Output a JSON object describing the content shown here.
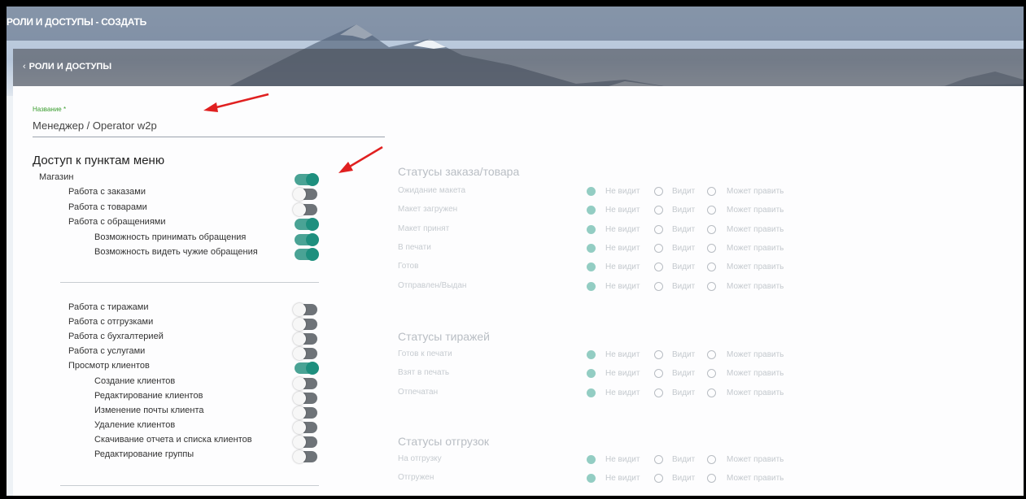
{
  "header": {
    "title": "РОЛИ И ДОСТУПЫ - СОЗДАТЬ",
    "back_label": "РОЛИ И ДОСТУПЫ"
  },
  "form": {
    "name_label": "Название *",
    "name_value": "Менеджер / Operator w2p"
  },
  "menu_access": {
    "title": "Доступ к пунктам меню",
    "items_a": [
      {
        "label": "Магазин",
        "on": true
      },
      {
        "label": "Работа с заказами",
        "on": false
      },
      {
        "label": "Работа с товарами",
        "on": false
      },
      {
        "label": "Работа с обращениями",
        "on": true
      },
      {
        "label": "Возможность принимать обращения",
        "on": true
      },
      {
        "label": "Возможность видеть чужие обращения",
        "on": true
      }
    ],
    "items_b": [
      {
        "label": "Работа с тиражами",
        "on": false
      },
      {
        "label": "Работа с отгрузками",
        "on": false
      },
      {
        "label": "Работа с бухгалтерией",
        "on": false
      },
      {
        "label": "Работа с услугами",
        "on": false
      },
      {
        "label": "Просмотр клиентов",
        "on": true
      },
      {
        "label": "Создание клиентов",
        "on": false
      },
      {
        "label": "Редактирование клиентов",
        "on": false
      },
      {
        "label": "Изменение почты клиента",
        "on": false
      },
      {
        "label": "Удаление клиентов",
        "on": false
      },
      {
        "label": "Скачивание отчета и списка клиентов",
        "on": false
      },
      {
        "label": "Редактирование группы",
        "on": false
      }
    ]
  },
  "radio_options": {
    "hidden": "Не видит",
    "view": "Видит",
    "edit": "Может править"
  },
  "status_groups": [
    {
      "title": "Статусы заказа/товара",
      "rows": [
        "Ожидание макета",
        "Макет загружен",
        "Макет принят",
        "В печати",
        "Готов",
        "Отправлен/Выдан"
      ]
    },
    {
      "title": "Статусы тиражей",
      "rows": [
        "Готов к печати",
        "Взят в печать",
        "Отпечатан"
      ]
    },
    {
      "title": "Статусы отгрузок",
      "rows": [
        "На отгрузку",
        "Отгружен"
      ]
    }
  ],
  "colors": {
    "accent": "#1e8f7e",
    "label_green": "#3a9d2e",
    "arrow_red": "#e02020"
  }
}
